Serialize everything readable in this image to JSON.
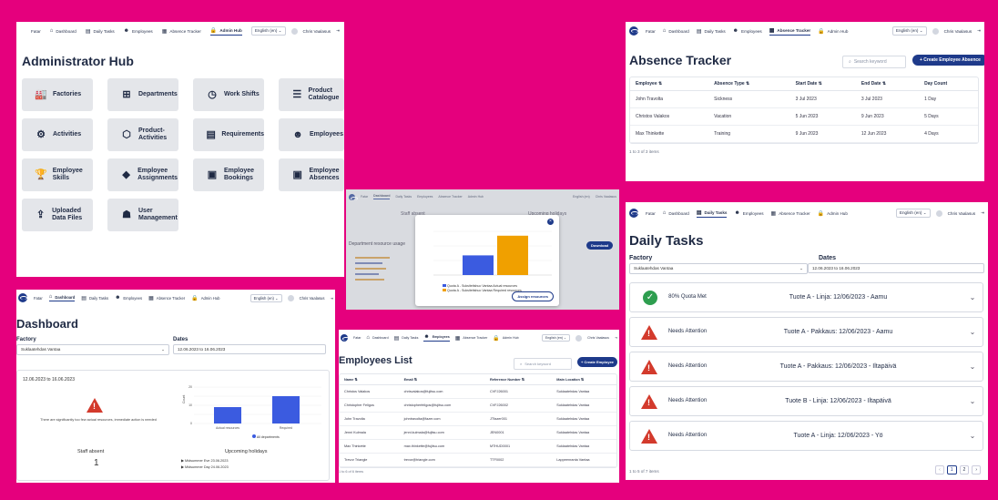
{
  "nav": {
    "brand": "Fatar",
    "items": [
      "Dashboard",
      "Daily Tasks",
      "Employees",
      "Absence Tracker",
      "Admin Hub"
    ],
    "language": "English (en)",
    "user": "Chris Vaalasus"
  },
  "admin": {
    "title": "Administrator Hub",
    "tiles": [
      "Factories",
      "Departments",
      "Work Shifts",
      "Product Catalogue",
      "Activities",
      "Product-Activities",
      "Requirements",
      "Employees",
      "Employee Skills",
      "Employee Assignments",
      "Employee Bookings",
      "Employee Absences",
      "Uploaded Data Files",
      "User Management"
    ]
  },
  "absence": {
    "title": "Absence Tracker",
    "search_placeholder": "Search keyword",
    "create_button": "+ Create Employee Absence",
    "columns": [
      "Employee ⇅",
      "Absence Type ⇅",
      "Start Date ⇅",
      "End Date ⇅",
      "Day Count"
    ],
    "rows": [
      [
        "John Travolta",
        "Sickness",
        "3 Jul 2023",
        "3 Jul 2023",
        "1 Day"
      ],
      [
        "Christos Valakos",
        "Vacation",
        "5 Jun 2023",
        "9 Jun 2023",
        "5 Days"
      ],
      [
        "Max Thinkette",
        "Training",
        "9 Jun 2023",
        "12 Jun 2023",
        "4 Days"
      ]
    ],
    "footer": "1 to 3 of 3 items"
  },
  "overlay": {
    "staff_absent": "Staff absent",
    "upcoming": "Upcoming holidays",
    "resource_usage": "Department resource usage",
    "download": "Download",
    "assign": "Assign resources",
    "legend": [
      "Quota A - Suksiteitshuo Vantaa Actual resources",
      "Quota A - Suksiteitshuo Vantaa Required resources"
    ],
    "bar_values": [
      0.45,
      0.9
    ]
  },
  "tasks": {
    "title": "Daily Tasks",
    "factory_label": "Factory",
    "dates_label": "Dates",
    "factory_value": "Suklaatehdas Vantaa",
    "dates_value": "12.06.2023 to 16.06.2023",
    "items": [
      {
        "status": "80% Quota Met",
        "name": "Tuote A - Linja: 12/06/2023 - Aamu",
        "ok": true
      },
      {
        "status": "Needs Attention",
        "name": "Tuote A - Pakkaus: 12/06/2023 - Aamu",
        "ok": false
      },
      {
        "status": "Needs Attention",
        "name": "Tuote A - Pakkaus: 12/06/2023 - Iltapäivä",
        "ok": false
      },
      {
        "status": "Needs Attention",
        "name": "Tuote B - Linja: 12/06/2023 - Iltapäivä",
        "ok": false
      },
      {
        "status": "Needs Attention",
        "name": "Tuote A - Linja: 12/06/2023 - Yö",
        "ok": false
      }
    ],
    "footer": "1 to 5 of 7 items",
    "pages": [
      "‹",
      "1",
      "2",
      "›"
    ]
  },
  "dashboard": {
    "title": "Dashboard",
    "factory_label": "Factory",
    "dates_label": "Dates",
    "factory_value": "Suklaatehdas Vantaa",
    "dates_value": "12.06.2023 to 16.06.2023",
    "range": "12.06.2023 to 16.06.2023",
    "warning": "There are significantly too few actual resources, immediate action is needed",
    "bars": [
      {
        "label": "Actual resources",
        "value": 9
      },
      {
        "label": "Required",
        "value": 15
      }
    ],
    "ylim": [
      0,
      20
    ],
    "legend": "All departments",
    "staff_absent_label": "Staff absent",
    "staff_absent_value": "1",
    "holidays_label": "Upcoming holidays",
    "holidays": [
      "Midsummer Eve 23.06.2023",
      "Midsummer Day 24.06.2023"
    ]
  },
  "employees": {
    "title": "Employees List",
    "search_placeholder": "Search keyword",
    "create_button": "+ Create Employee",
    "columns": [
      "Name ⇅",
      "Email ⇅",
      "Reference Number ⇅",
      "Main Location ⇅"
    ],
    "rows": [
      [
        "Christos Valakos",
        "chrisvalakos@fujitsu.com",
        "CVFJ26001",
        "Suklaatehdas Vantaa"
      ],
      [
        "Christopher Feligos",
        "christopherfeligos@fujitsu.com",
        "CVFJ26002",
        "Suklaatehdas Vantaa"
      ],
      [
        "John Travolta",
        "johntravolta@fazer.com",
        "JTfazer001",
        "Suklaatehdas Vantaa"
      ],
      [
        "Jenni Kulmala",
        "jenni.kulmala@fujitsu.com",
        "JEN0001",
        "Suklaatehdas Vantaa"
      ],
      [
        "Max Thinkette",
        "max.thinkette@fujitsu.com",
        "MTHUD0001",
        "Suklaatehdas Vantaa"
      ],
      [
        "Trevor Triangle",
        "trevor@triangle.com",
        "TTF0002",
        "Lappeenranta Vantaa"
      ]
    ],
    "footer": "1 to 6 of 6 items"
  }
}
